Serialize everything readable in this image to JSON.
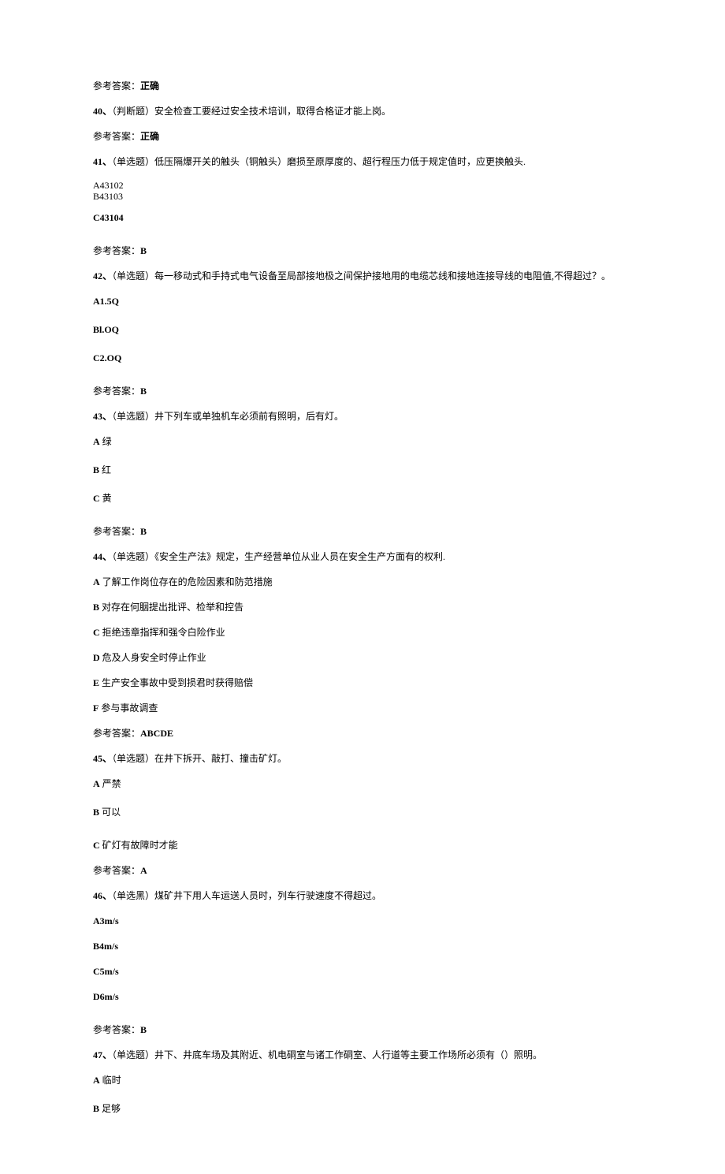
{
  "ans39": {
    "label": "参考答案：",
    "value": "正确"
  },
  "q40": {
    "num": "40、",
    "type": "（判断题）",
    "text": "安全检查工要经过安全技术培训，取得合格证才能上岗。"
  },
  "ans40": {
    "label": "参考答案：",
    "value": "正确"
  },
  "q41": {
    "num": "41、",
    "type": "（单选题）",
    "text": "低压隔爆开关的触头（铜触头）磨损至原厚度的、超行程压力低于规定值时，应更换触头."
  },
  "q41opts": {
    "a": "A43102",
    "b": "B43103",
    "c": "C43104"
  },
  "ans41": {
    "label": "参考答案：",
    "value": "B"
  },
  "q42": {
    "num": "42、",
    "type": "（单选题）",
    "text": "每一移动式和手持式电气设备至局部接地极之间保护接地用的电缆芯线和接地连接导线的电阻值,不得超过？。"
  },
  "q42opts": {
    "a": "A1.5Q",
    "b": "Bl.OQ",
    "c": "C2.OQ"
  },
  "ans42": {
    "label": "参考答案：",
    "value": "B"
  },
  "q43": {
    "num": "43、",
    "type": "（单选题）",
    "text": "井下列车或单独机车必须前有照明，后有灯。"
  },
  "q43opts": {
    "a": {
      "l": "A",
      "t": " 绿"
    },
    "b": {
      "l": "B",
      "t": " 红"
    },
    "c": {
      "l": "C",
      "t": " 黄"
    }
  },
  "ans43": {
    "label": "参考答案：",
    "value": "B"
  },
  "q44": {
    "num": "44、",
    "type": "（单选题）",
    "text": "《安全生产法》规定，生产经营单位从业人员在安全生产方面有的权利."
  },
  "q44opts": {
    "a": {
      "l": "A",
      "t": " 了解工作岗位存在的危险因素和防范措施"
    },
    "b": {
      "l": "B",
      "t": " 对存在何胭提出批评、检举和控告"
    },
    "c": {
      "l": "C",
      "t": " 拒绝违章指挥和强令白险作业"
    },
    "d": {
      "l": "D",
      "t": " 危及人身安全时停止作业"
    },
    "e": {
      "l": "E",
      "t": " 生产安全事故中受到损君时获得赔偿"
    },
    "f": {
      "l": "F",
      "t": " 参与事故调查"
    }
  },
  "ans44": {
    "label": "参考答案：",
    "value": "ABCDE"
  },
  "q45": {
    "num": "45、",
    "type": "（单选题）",
    "text": "在井下拆开、敲打、撞击矿灯。"
  },
  "q45opts": {
    "a": {
      "l": "A",
      "t": " 严禁"
    },
    "b": {
      "l": "B",
      "t": " 可以"
    },
    "c": {
      "l": "C",
      "t": " 矿灯有故障时才能"
    }
  },
  "ans45": {
    "label": "参考答案：",
    "value": "A"
  },
  "q46": {
    "num": "46、",
    "type": "（单选黑）",
    "text": "煤矿井下用人车运送人员时，列车行驶速度不得超过。"
  },
  "q46opts": {
    "a": "A3m/s",
    "b": "B4m/s",
    "c": "C5m/s",
    "d": "D6m/s"
  },
  "ans46": {
    "label": "参考答案：",
    "value": "B"
  },
  "q47": {
    "num": "47、",
    "type": "（单选题）",
    "text": "井下、井底车场及其附近、机电硐室与诸工作硐室、人行道等主要工作场所必须有（）照明。"
  },
  "q47opts": {
    "a": {
      "l": "A",
      "t": " 临时"
    },
    "b": {
      "l": "B",
      "t": " 足够"
    }
  }
}
